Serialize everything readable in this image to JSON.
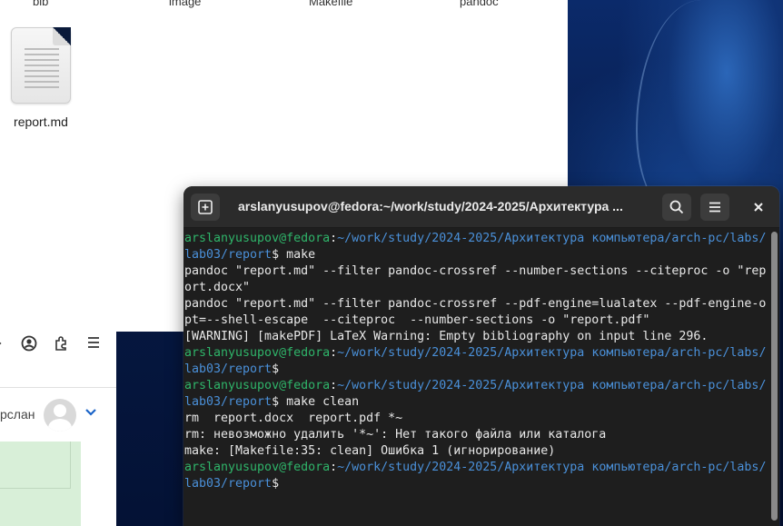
{
  "files": {
    "top_labels": [
      "bib",
      "image",
      "Makefile",
      "pandoc"
    ],
    "item_name": "report.md"
  },
  "browser": {
    "user_name": "рслан"
  },
  "terminal": {
    "title": "arslanyusupov@fedora:~/work/study/2024-2025/Архитектура ...",
    "lines": [
      [
        [
          "u",
          "arslanyusupov@fedora"
        ],
        [
          "t",
          ":"
        ],
        [
          "p",
          "~/work/study/2024-2025/Архитектура компьютера/arch-pc/labs/"
        ]
      ],
      [
        [
          "p",
          "lab03/report"
        ],
        [
          "t",
          "$ make"
        ]
      ],
      [
        [
          "t",
          "pandoc \"report.md\" --filter pandoc-crossref --number-sections --citeproc -o \"rep"
        ]
      ],
      [
        [
          "t",
          "ort.docx\""
        ]
      ],
      [
        [
          "t",
          "pandoc \"report.md\" --filter pandoc-crossref --pdf-engine=lualatex --pdf-engine-o"
        ]
      ],
      [
        [
          "t",
          "pt=--shell-escape  --citeproc  --number-sections -o \"report.pdf\""
        ]
      ],
      [
        [
          "t",
          "[WARNING] [makePDF] LaTeX Warning: Empty bibliography on input line 296."
        ]
      ],
      [
        [
          "u",
          "arslanyusupov@fedora"
        ],
        [
          "t",
          ":"
        ],
        [
          "p",
          "~/work/study/2024-2025/Архитектура компьютера/arch-pc/labs/"
        ]
      ],
      [
        [
          "p",
          "lab03/report"
        ],
        [
          "t",
          "$"
        ]
      ],
      [
        [
          "u",
          "arslanyusupov@fedora"
        ],
        [
          "t",
          ":"
        ],
        [
          "p",
          "~/work/study/2024-2025/Архитектура компьютера/arch-pc/labs/"
        ]
      ],
      [
        [
          "p",
          "lab03/report"
        ],
        [
          "t",
          "$ make clean"
        ]
      ],
      [
        [
          "t",
          "rm  report.docx  report.pdf *~"
        ]
      ],
      [
        [
          "t",
          "rm: невозможно удалить '*~': Нет такого файла или каталога"
        ]
      ],
      [
        [
          "t",
          "make: [Makefile:35: clean] Ошибка 1 (игнорирование)"
        ]
      ],
      [
        [
          "u",
          "arslanyusupov@fedora"
        ],
        [
          "t",
          ":"
        ],
        [
          "p",
          "~/work/study/2024-2025/Архитектура компьютера/arch-pc/labs/"
        ]
      ],
      [
        [
          "p",
          "lab03/report"
        ],
        [
          "t",
          "$"
        ]
      ]
    ]
  },
  "colors": {
    "user": "#2fb56a",
    "path": "#4a90d9",
    "text": "#e8e8e8",
    "terminal_bg": "#1e1e1e"
  }
}
